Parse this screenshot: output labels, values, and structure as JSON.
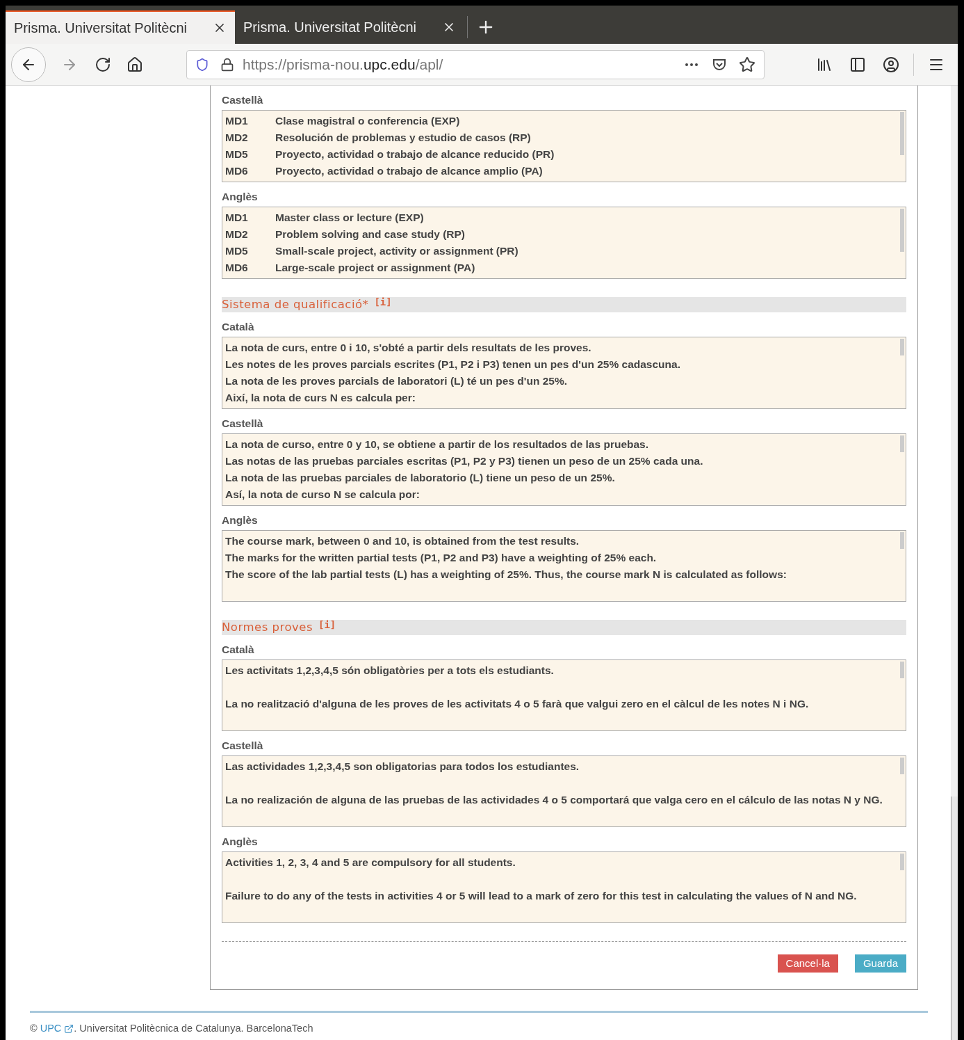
{
  "tabs": [
    {
      "title": "Prisma. Universitat Politècni",
      "selected": true
    },
    {
      "title": "Prisma. Universitat Politècni",
      "selected": false
    }
  ],
  "url": {
    "prefix": "https://prisma-nou.",
    "domain": "upc.edu",
    "path": "/apl/"
  },
  "blocks": [
    {
      "kind": "list",
      "label": "Castellà",
      "rows": [
        {
          "code": "MD1",
          "text": "Clase magistral o conferencia (EXP)"
        },
        {
          "code": "MD2",
          "text": "Resolución de problemas y estudio de casos (RP)"
        },
        {
          "code": "MD5",
          "text": "Proyecto, actividad o trabajo de alcance reducido (PR)"
        },
        {
          "code": "MD6",
          "text": "Proyecto, actividad o trabajo de alcance amplio (PA)"
        }
      ]
    },
    {
      "kind": "list",
      "label": "Anglès",
      "rows": [
        {
          "code": "MD1",
          "text": "Master class or lecture (EXP)"
        },
        {
          "code": "MD2",
          "text": "Problem solving and case study (RP)"
        },
        {
          "code": "MD5",
          "text": "Small-scale project, activity or assignment (PR)"
        },
        {
          "code": "MD6",
          "text": "Large-scale project or assignment (PA)"
        }
      ]
    },
    {
      "kind": "heading",
      "title": "Sistema de qualificació*",
      "info": "[i]"
    },
    {
      "kind": "text",
      "label": "Català",
      "paragraphs": [
        "La nota de curs, entre 0 i 10, s'obté a partir dels resultats de les proves.",
        "Les notes de les proves parcials escrites (P1, P2 i P3) tenen un pes d'un 25% cadascuna.",
        "La nota de les proves parcials de laboratori (L) té un pes d'un 25%.",
        "Així, la nota de curs N es calcula per:"
      ],
      "spaced": false
    },
    {
      "kind": "text",
      "label": "Castellà",
      "paragraphs": [
        "La nota de curso, entre 0 y 10, se obtiene a partir de los resultados de las pruebas.",
        "Las notas de las pruebas parciales escritas (P1, P2 y P3) tienen un peso de un 25% cada una.",
        "La nota de las pruebas parciales de laboratorio (L) tiene un peso de un 25%.",
        "Así, la nota de curso N se calcula por:"
      ],
      "spaced": false
    },
    {
      "kind": "text",
      "label": "Anglès",
      "paragraphs": [
        "The course mark, between 0 and 10, is obtained from the test results.",
        "The marks for the written partial tests (P1, P2 and P3) have a weighting of 25% each.",
        "The score of the lab partial tests (L) has a weighting of 25%. Thus, the course mark N is calculated as follows:"
      ],
      "spaced": false
    },
    {
      "kind": "heading",
      "title": "Normes proves",
      "info": "[i]"
    },
    {
      "kind": "text",
      "label": "Català",
      "paragraphs": [
        "Les activitats 1,2,3,4,5 són obligatòries per a tots els estudiants.",
        "La no realització d'alguna de les proves de les activitats 4 o 5 farà que valgui zero en el càlcul de les notes N i NG."
      ],
      "spaced": true
    },
    {
      "kind": "text",
      "label": "Castellà",
      "paragraphs": [
        "Las actividades 1,2,3,4,5 son obligatorias para todos los estudiantes.",
        "La no realización de alguna de las pruebas de las actividades 4 o 5 comportará que valga cero en el cálculo de las notas N y NG."
      ],
      "spaced": true
    },
    {
      "kind": "text",
      "label": "Anglès",
      "paragraphs": [
        "Activities 1, 2, 3, 4 and 5 are compulsory for all students.",
        "Failure to do any of the tests in activities 4 or 5 will lead to a mark of zero for this test in calculating the values of N and NG."
      ],
      "spaced": true
    }
  ],
  "buttons": [
    {
      "label": "Cancel·la",
      "kind": "cancel"
    },
    {
      "label": "Guarda",
      "kind": "save"
    }
  ],
  "footer": {
    "copyright": "©",
    "link": "UPC",
    "text": ". Universitat Politècnica de Catalunya. BarcelonaTech"
  }
}
